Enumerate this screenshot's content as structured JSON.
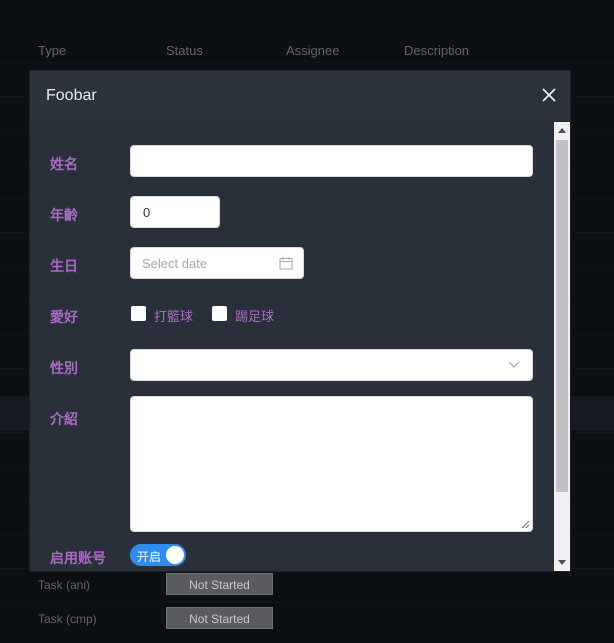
{
  "table": {
    "columns": [
      "Type",
      "Status",
      "Assignee",
      "Description"
    ],
    "rows": [
      {
        "type": "Task (ani)",
        "status": "Not Started"
      },
      {
        "type": "Task (cmp)",
        "status": "Not Started"
      }
    ]
  },
  "modal": {
    "title": "Foobar",
    "form": {
      "name_label": "姓名",
      "name_value": "",
      "age_label": "年齡",
      "age_value": "0",
      "birthday_label": "生日",
      "birthday_placeholder": "Select date",
      "hobby_label": "愛好",
      "hobbies": [
        "打籃球",
        "踢足球"
      ],
      "gender_label": "性別",
      "gender_value": "",
      "intro_label": "介紹",
      "intro_value": "",
      "enable_label": "启用账号",
      "enable_toggle_text": "开启"
    }
  },
  "colors": {
    "label": "#a86bc2",
    "toggle_on": "#2d8cf0",
    "modal_bg": "#2a3039"
  }
}
